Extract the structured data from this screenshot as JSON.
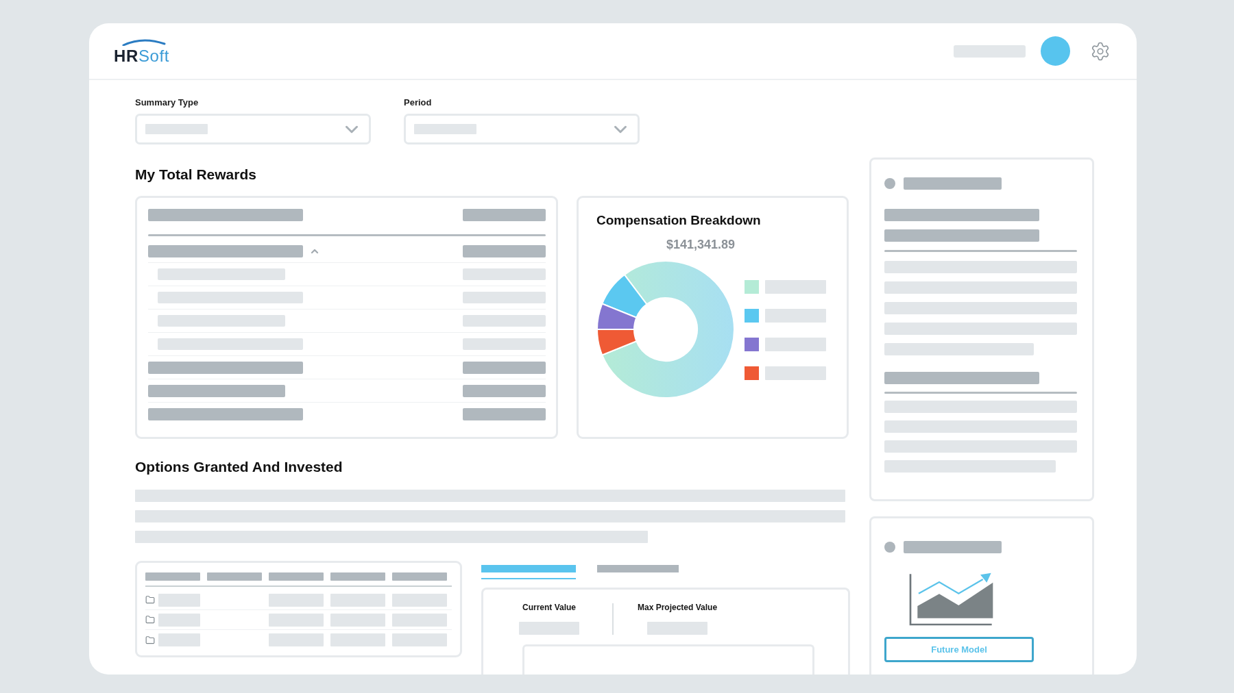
{
  "header": {
    "logo": "**HR**Soft"
  },
  "filters": [
    {
      "label": "Summary Type"
    },
    {
      "label": "Period"
    }
  ],
  "total_rewards": {
    "title": "My Total Rewards",
    "table": {
      "rows": [
        {
          "kind": "header"
        },
        {
          "kind": "group",
          "expanded": true,
          "children": [
            {
              "kind": "item"
            },
            {
              "kind": "item"
            },
            {
              "kind": "item"
            },
            {
              "kind": "item"
            }
          ]
        },
        {
          "kind": "total"
        },
        {
          "kind": "total"
        },
        {
          "kind": "total"
        }
      ]
    },
    "breakdown": {
      "title": "Compensation Breakdown",
      "amount": "$141,341.89",
      "legend": [
        {
          "color": "#b4ebd6"
        },
        {
          "color": "#5bc8f0"
        },
        {
          "color": "#8476d0"
        },
        {
          "color": "#ef5a35"
        }
      ]
    }
  },
  "options": {
    "title": "Options Granted And Invested",
    "table": {
      "rows": [
        {
          "kind": "folder"
        },
        {
          "kind": "folder"
        },
        {
          "kind": "folder"
        }
      ]
    },
    "tabs": [
      {
        "selected": true
      },
      {
        "selected": false
      }
    ],
    "values": [
      {
        "label": "Current Value"
      },
      {
        "label": "Max Projected Value"
      }
    ]
  },
  "side_panels": [
    {
      "kind": "summary"
    },
    {
      "kind": "model",
      "button": "Future Model"
    }
  ]
}
